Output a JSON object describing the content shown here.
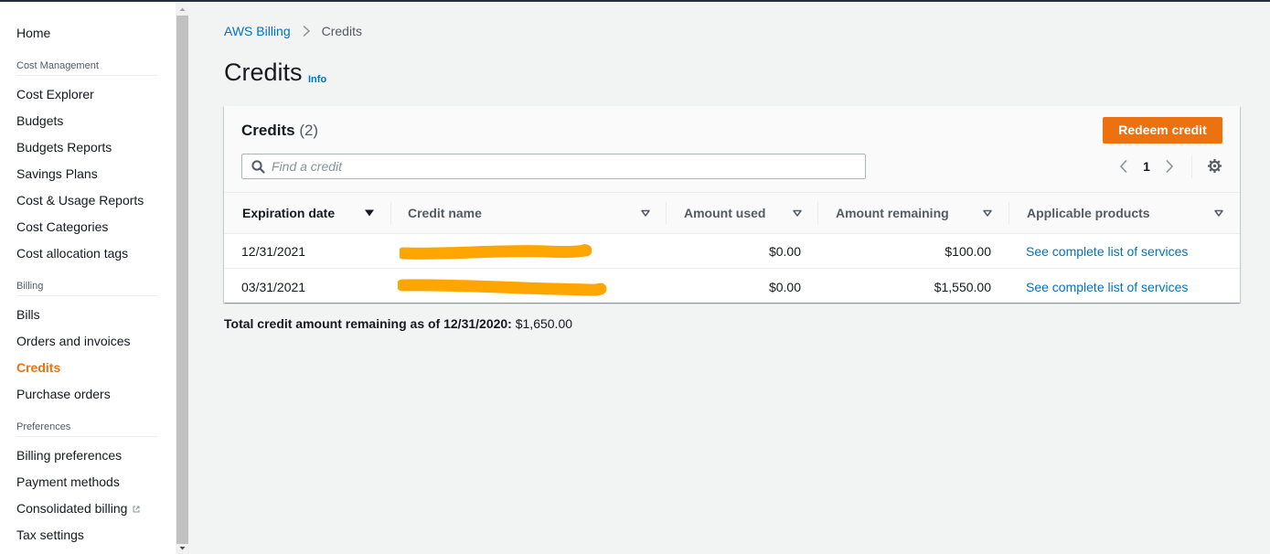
{
  "sidebar": {
    "home": "Home",
    "sections": {
      "cost_management": "Cost Management",
      "billing": "Billing",
      "preferences": "Preferences"
    },
    "cost_items": [
      "Cost Explorer",
      "Budgets",
      "Budgets Reports",
      "Savings Plans",
      "Cost & Usage Reports",
      "Cost Categories",
      "Cost allocation tags"
    ],
    "billing_items": [
      "Bills",
      "Orders and invoices",
      "Credits",
      "Purchase orders"
    ],
    "preference_items": [
      "Billing preferences",
      "Payment methods",
      "Consolidated billing",
      "Tax settings"
    ],
    "active_item": "Credits"
  },
  "breadcrumb": {
    "root": "AWS Billing",
    "current": "Credits"
  },
  "page": {
    "title": "Credits",
    "info": "Info"
  },
  "panel": {
    "title": "Credits",
    "count": "(2)",
    "redeem_label": "Redeem credit",
    "search_placeholder": "Find a credit",
    "page_number": "1"
  },
  "table": {
    "columns": [
      "Expiration date",
      "Credit name",
      "Amount used",
      "Amount remaining",
      "Applicable products"
    ],
    "rows": [
      {
        "expiration": "12/31/2021",
        "used": "$0.00",
        "remaining": "$100.00",
        "products": "See complete list of services"
      },
      {
        "expiration": "03/31/2021",
        "used": "$0.00",
        "remaining": "$1,550.00",
        "products": "See complete list of services"
      }
    ]
  },
  "total": {
    "label": "Total credit amount remaining as of 12/31/2020:",
    "value": "$1,650.00"
  },
  "colors": {
    "accent": "#ec7211",
    "link": "#0073bb",
    "redaction": "#ffa500"
  }
}
